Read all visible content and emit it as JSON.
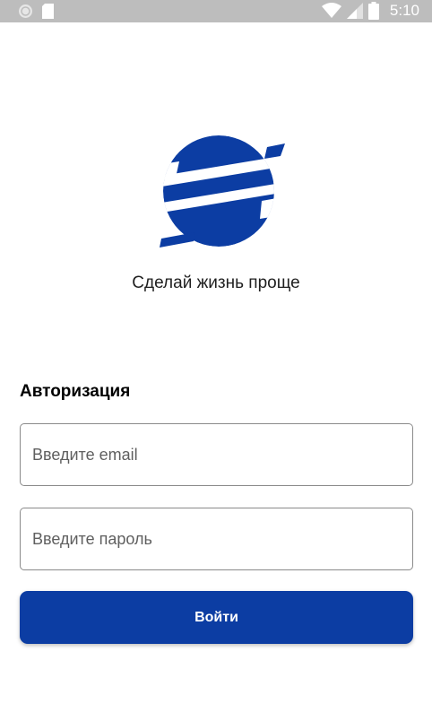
{
  "status_bar": {
    "time": "5:10",
    "icons": [
      "sync-icon",
      "sd-card-icon",
      "wifi-icon",
      "signal-icon",
      "battery-icon"
    ]
  },
  "brand": {
    "logo": "company-logo",
    "tagline": "Сделай жизнь проще",
    "color": "#0c3da3"
  },
  "auth": {
    "title": "Авторизация",
    "email_placeholder": "Введите email",
    "email_value": "",
    "password_placeholder": "Введите пароль",
    "password_value": "",
    "login_label": "Войти"
  }
}
